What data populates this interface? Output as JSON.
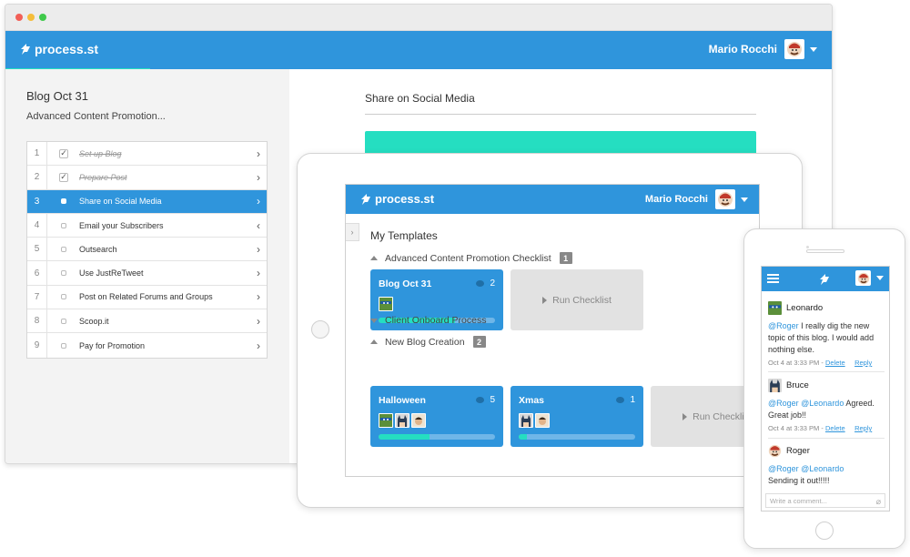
{
  "brand": {
    "logo_text": "process.st",
    "accent": "#2f95dc",
    "progress": "#25dec1"
  },
  "user": {
    "name": "Mario Rocchi",
    "avatar_icon": "avatar-mario-icon"
  },
  "desktop": {
    "checklist_title": "Blog Oct 31",
    "checklist_subtitle": "Advanced Content Promotion...",
    "tasks": [
      {
        "num": "1",
        "label": "Set up Blog",
        "done": true
      },
      {
        "num": "2",
        "label": "Prepare Post",
        "done": true
      },
      {
        "num": "3",
        "label": "Share on Social Media",
        "active": true
      },
      {
        "num": "4",
        "label": "Email your Subscribers"
      },
      {
        "num": "5",
        "label": "Outsearch"
      },
      {
        "num": "6",
        "label": "Use JustReTweet"
      },
      {
        "num": "7",
        "label": "Post on Related Forums and Groups"
      },
      {
        "num": "8",
        "label": "Scoop.it"
      },
      {
        "num": "9",
        "label": "Pay for Promotion"
      }
    ],
    "step_title": "Share on Social Media"
  },
  "tablet": {
    "heading": "My Templates",
    "groups": [
      {
        "name": "Advanced Content Promotion Checklist",
        "count": "1"
      },
      {
        "name": "Client Onboard Process"
      },
      {
        "name": "New Blog Creation",
        "count": "2"
      }
    ],
    "cards": [
      {
        "title": "Blog Oct 31",
        "comments": "2",
        "progress": 0.66
      },
      {
        "title": "Halloween",
        "comments": "5",
        "progress": 0.44
      },
      {
        "title": "Xmas",
        "comments": "1",
        "progress": 0.07
      }
    ],
    "run_checklist_label": "Run Checklist"
  },
  "phone": {
    "comments": [
      {
        "author": "Leonardo",
        "mentions": "@Roger",
        "text": " I really dig the new topic of this blog. I would add nothing else.",
        "time": "Oct 4 at 3:33 PM - ",
        "delete": "Delete",
        "reply": "Reply"
      },
      {
        "author": "Bruce",
        "mentions": "@Roger @Leonardo",
        "text": " Agreed. Great job!!",
        "time": "Oct 4 at 3:33 PM - ",
        "delete": "Delete",
        "reply": "Reply"
      },
      {
        "author": "Roger",
        "mentions": "@Roger @Leonardo",
        "text": "Sending it out!!!!!"
      }
    ],
    "input_placeholder": "Write a comment..."
  }
}
